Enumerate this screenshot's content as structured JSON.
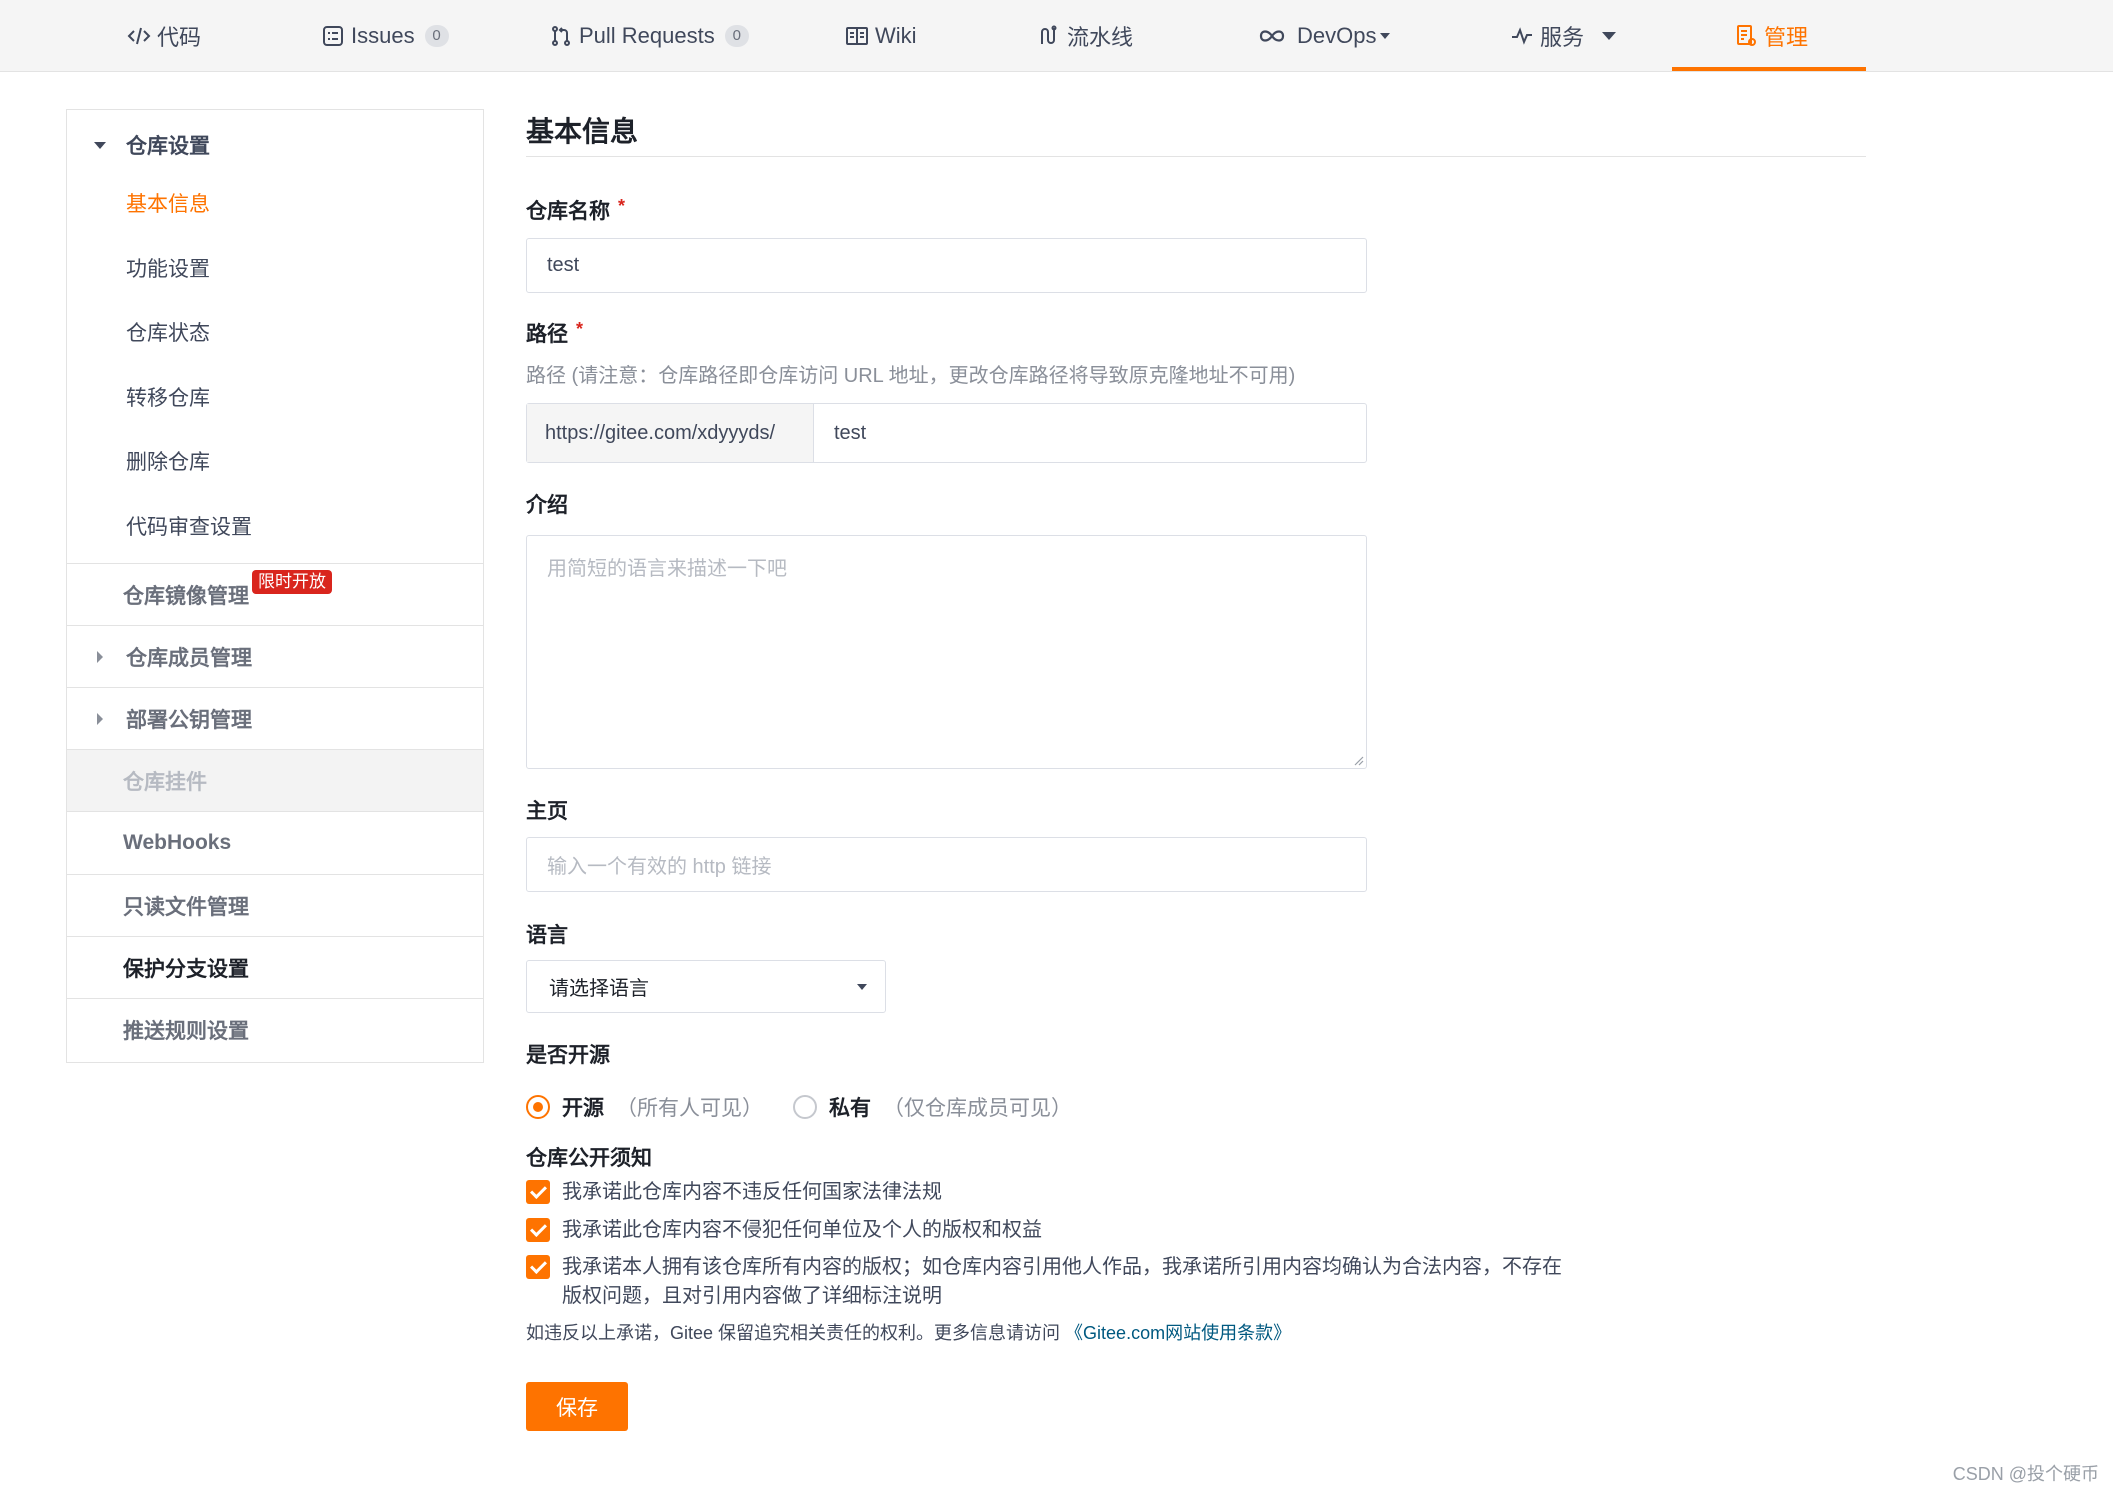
{
  "nav": {
    "tabs": [
      {
        "label": "代码",
        "icon": "code-icon"
      },
      {
        "label": "Issues",
        "icon": "issues-icon",
        "count": "0"
      },
      {
        "label": "Pull Requests",
        "icon": "pull-request-icon",
        "count": "0"
      },
      {
        "label": "Wiki",
        "icon": "book-icon"
      },
      {
        "label": "流水线",
        "icon": "pipeline-icon"
      },
      {
        "label": "DevOps",
        "icon": "infinity-icon"
      },
      {
        "label": "服务",
        "icon": "pulse-icon"
      },
      {
        "label": "管理",
        "icon": "manage-icon",
        "active": true
      }
    ]
  },
  "sidebar": {
    "group_title": "仓库设置",
    "sub_items": [
      "基本信息",
      "功能设置",
      "仓库状态",
      "转移仓库",
      "删除仓库",
      "代码审查设置"
    ],
    "items": [
      {
        "label": "仓库镜像管理",
        "badge": "限时开放"
      },
      {
        "label": "仓库成员管理"
      },
      {
        "label": "部署公钥管理"
      },
      {
        "label": "仓库挂件"
      },
      {
        "label": "WebHooks"
      },
      {
        "label": "只读文件管理"
      },
      {
        "label": "保护分支设置"
      },
      {
        "label": "推送规则设置"
      }
    ]
  },
  "main": {
    "title": "基本信息",
    "repo_name": {
      "label": "仓库名称",
      "required": "*",
      "value": "test"
    },
    "path": {
      "label": "路径",
      "required": "*",
      "hint": "路径 (请注意：仓库路径即仓库访问 URL 地址，更改仓库路径将导致原克隆地址不可用)",
      "prefix": "https://gitee.com/xdyyyds/",
      "value": "test"
    },
    "intro": {
      "label": "介绍",
      "placeholder": "用简短的语言来描述一下吧"
    },
    "homepage": {
      "label": "主页",
      "placeholder": "输入一个有效的 http 链接"
    },
    "language": {
      "label": "语言",
      "selected": "请选择语言"
    },
    "open_source": {
      "label": "是否开源",
      "options": [
        {
          "label": "开源",
          "desc": "（所有人可见）",
          "checked": true
        },
        {
          "label": "私有",
          "desc": "（仅仓库成员可见）",
          "checked": false
        }
      ]
    },
    "notice": {
      "label": "仓库公开须知",
      "checks": [
        "我承诺此仓库内容不违反任何国家法律法规",
        "我承诺此仓库内容不侵犯任何单位及个人的版权和权益",
        "我承诺本人拥有该仓库所有内容的版权；如仓库内容引用他人作品，我承诺所引用内容均确认为合法内容，不存在版权问题，且对引用内容做了详细标注说明"
      ],
      "footer_text": "如违反以上承诺，Gitee 保留追究相关责任的权利。更多信息请访问",
      "footer_link": "《Gitee.com网站使用条款》"
    },
    "save_label": "保存"
  },
  "watermark": "CSDN @投个硬币",
  "colors": {
    "accent": "#fe7300",
    "required": "#d9251d",
    "link": "#005980"
  }
}
